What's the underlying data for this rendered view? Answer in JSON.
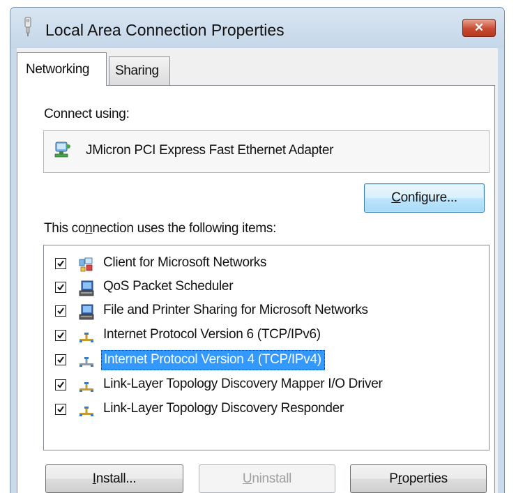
{
  "window": {
    "title": "Local Area Connection Properties",
    "close_label": "✕"
  },
  "tabs": [
    {
      "label": "Networking",
      "active": true
    },
    {
      "label": "Sharing",
      "active": false
    }
  ],
  "connect_using": {
    "label_pre": "Connect using:",
    "adapter_name": "JMicron PCI Express Fast Ethernet Adapter",
    "adapter_icon": "network-adapter-icon"
  },
  "configure_button": {
    "pre": "",
    "accel": "C",
    "post": "onfigure..."
  },
  "items_label": {
    "pre": "This co",
    "accel": "n",
    "post": "nection uses the following items:"
  },
  "items": [
    {
      "label": "Client for Microsoft Networks",
      "checked": true,
      "icon": "network-client-icon",
      "selected": false
    },
    {
      "label": "QoS Packet Scheduler",
      "checked": true,
      "icon": "network-service-icon",
      "selected": false
    },
    {
      "label": "File and Printer Sharing for Microsoft Networks",
      "checked": true,
      "icon": "network-service-icon",
      "selected": false
    },
    {
      "label": "Internet Protocol Version 6 (TCP/IPv6)",
      "checked": true,
      "icon": "network-protocol-icon",
      "selected": false
    },
    {
      "label": "Internet Protocol Version 4 (TCP/IPv4)",
      "checked": true,
      "icon": "network-protocol-icon",
      "selected": true
    },
    {
      "label": "Link-Layer Topology Discovery Mapper I/O Driver",
      "checked": true,
      "icon": "network-protocol-icon",
      "selected": false
    },
    {
      "label": "Link-Layer Topology Discovery Responder",
      "checked": true,
      "icon": "network-protocol-icon",
      "selected": false
    }
  ],
  "buttons": {
    "install": {
      "pre": "",
      "accel": "I",
      "post": "nstall..."
    },
    "uninstall": {
      "pre": "",
      "accel": "U",
      "post": "ninstall"
    },
    "properties": {
      "pre": "P",
      "accel": "r",
      "post": "operties"
    }
  },
  "colors": {
    "selection": "#3399ff",
    "default_button_border": "#3c7fb1",
    "close_button": "#c74a31"
  }
}
